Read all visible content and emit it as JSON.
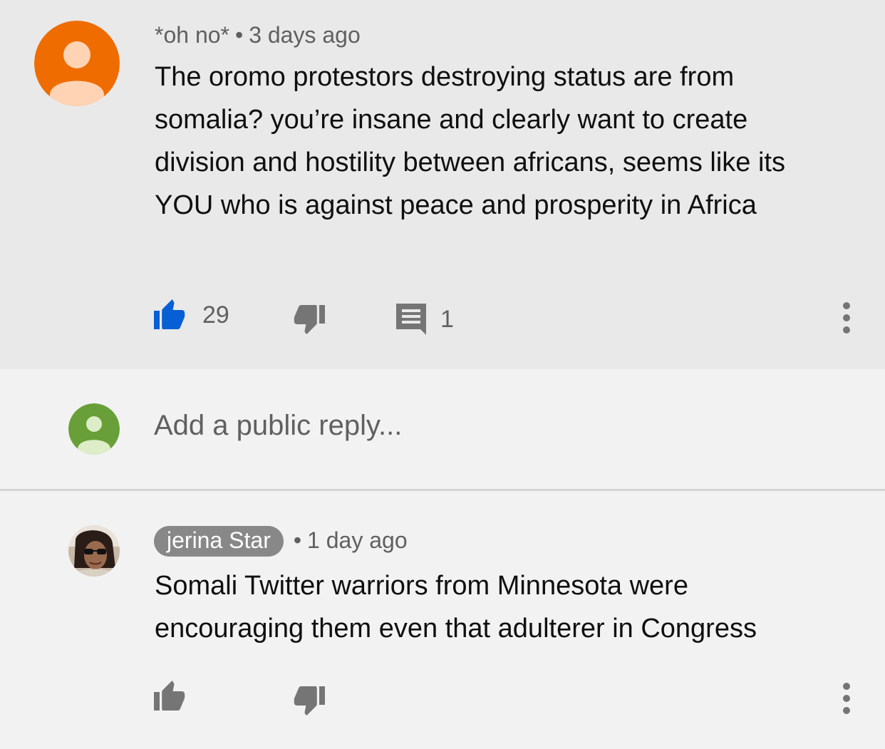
{
  "comment": {
    "author": "*oh no*",
    "separator": "•",
    "time": "3 days ago",
    "text": "The oromo protestors destroying status are from somalia? you’re insane and clearly want to create division and hostility between africans, seems like its YOU who is against peace and prosperity in Africa",
    "likes": "29",
    "replies": "1",
    "liked": true,
    "avatar_color": "#ef6c00",
    "like_color": "#065fd4"
  },
  "reply_box": {
    "placeholder": "Add a public reply...",
    "avatar_color": "#689f38"
  },
  "reply": {
    "author": "jerina Star",
    "separator": "•",
    "time": "1 day ago",
    "text": "Somali Twitter warriors from Minnesota were encouraging them even that adulterer in Congress",
    "author_chip_color": "#888888"
  },
  "icons": {
    "like": "thumbs-up-icon",
    "dislike": "thumbs-down-icon",
    "reply": "comment-icon",
    "more": "more-vert-icon"
  }
}
